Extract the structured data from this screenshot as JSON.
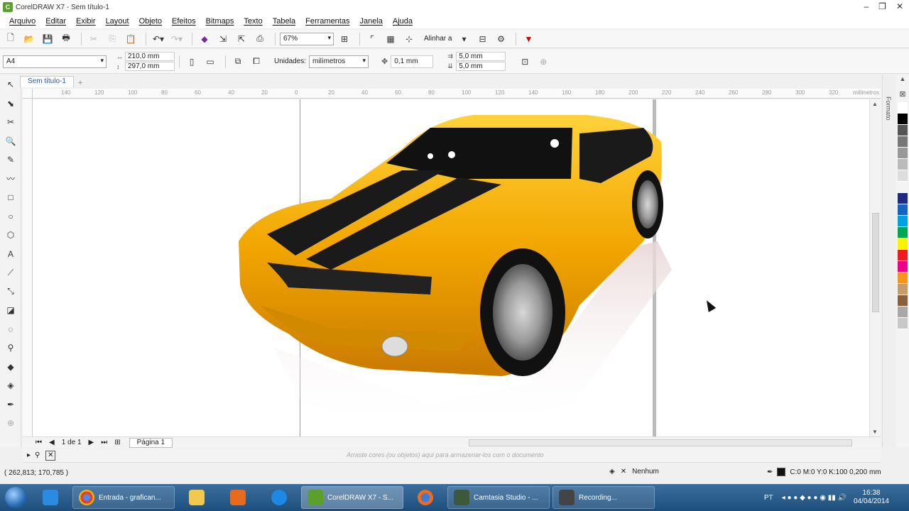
{
  "window": {
    "title": "CorelDRAW X7 - Sem título-1"
  },
  "menu": [
    "Arquivo",
    "Editar",
    "Exibir",
    "Layout",
    "Objeto",
    "Efeitos",
    "Bitmaps",
    "Texto",
    "Tabela",
    "Ferramentas",
    "Janela",
    "Ajuda"
  ],
  "toolbar": {
    "zoom": "67%",
    "align_label": "Alinhar a"
  },
  "property_bar": {
    "page_size": "A4",
    "width": "210,0 mm",
    "height": "297,0 mm",
    "units_label": "Unidades:",
    "units": "milímetros",
    "nudge": "0,1 mm",
    "dup_x": "5,0 mm",
    "dup_y": "5,0 mm"
  },
  "document_tab": "Sem título-1",
  "ruler": {
    "labels": [
      "140",
      "120",
      "100",
      "80",
      "60",
      "40",
      "20",
      "0",
      "20",
      "40",
      "60",
      "80",
      "100",
      "120",
      "140",
      "160",
      "180",
      "200",
      "220",
      "240",
      "260",
      "280",
      "300",
      "320"
    ],
    "unit": "milímetros"
  },
  "docker": {
    "label": "Formato"
  },
  "palette": [
    "#ffffff",
    "#000000",
    "#555555",
    "#777777",
    "#999999",
    "#bbbbbb",
    "#dddddd",
    "#f4f4f4",
    "#1f2a80",
    "#1565c0",
    "#00a0e3",
    "#00a651",
    "#fff200",
    "#ed1c24",
    "#ec008c",
    "#f7941d",
    "#c69c6d",
    "#8b5e3c",
    "#a8a8a8",
    "#c8c8c8"
  ],
  "page_nav": {
    "counter": "1 de 1",
    "page_tab": "Página 1"
  },
  "colorbar": {
    "hint": "Arraste cores (ou objetos) aqui para armazenar-los com o documento"
  },
  "status": {
    "coords": "( 262,813; 170,785 )",
    "fill": "Nenhum",
    "stroke": "C:0 M:0 Y:0 K:100  0,200 mm"
  },
  "taskbar": {
    "tasks": [
      "Entrada - grafican...",
      "CorelDRAW X7 - S...",
      "Camtasia Studio - ...",
      "Recording..."
    ],
    "lang": "PT",
    "time": "16:38",
    "date": "04/04/2014"
  }
}
